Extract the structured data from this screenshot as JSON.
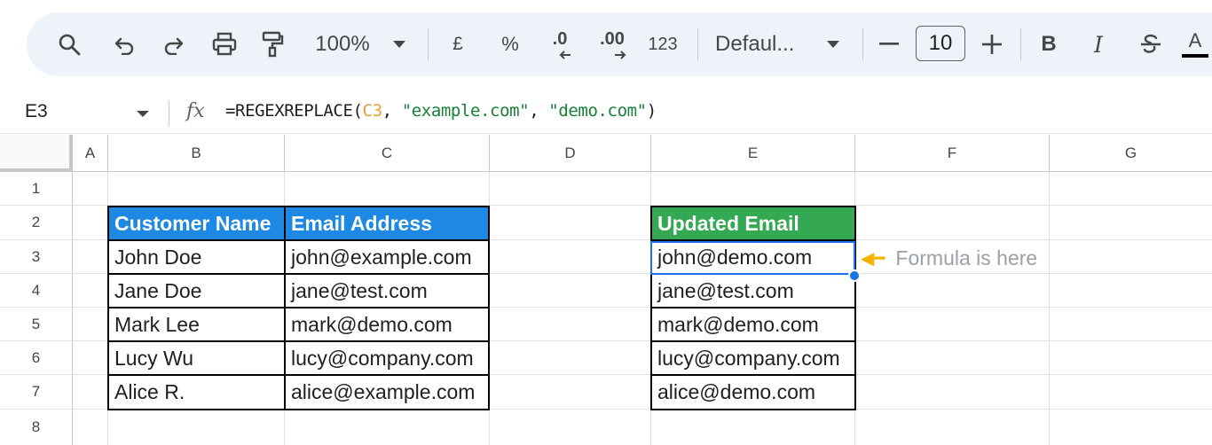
{
  "toolbar": {
    "zoom": "100%",
    "currency": "£",
    "percent": "%",
    "decrease_decimal": ".0",
    "increase_decimal": ".00",
    "number_format": "123",
    "font_name": "Defaul...",
    "font_size": "10",
    "icons": [
      "search-icon",
      "undo-icon",
      "redo-icon",
      "print-icon",
      "paint-format-icon",
      "dropdown-arrow-icon",
      "minus-icon",
      "plus-icon",
      "bold-icon",
      "italic-icon",
      "strikethrough-icon",
      "text-color-icon"
    ]
  },
  "formula_bar": {
    "name_box": "E3",
    "fx": "fx",
    "formula_prefix": "=REGEXREPLACE(",
    "formula_ref": "C3",
    "formula_sep1": ", ",
    "formula_arg1": "\"example.com\"",
    "formula_sep2": ", ",
    "formula_arg2": "\"demo.com\"",
    "formula_suffix": ")"
  },
  "columns": [
    "A",
    "B",
    "C",
    "D",
    "E",
    "F",
    "G"
  ],
  "rows": [
    "1",
    "2",
    "3",
    "4",
    "5",
    "6",
    "7",
    "8"
  ],
  "table": {
    "headers": [
      "Customer Name",
      "Email Address"
    ],
    "rows": [
      [
        "John Doe",
        "john@example.com"
      ],
      [
        "Jane Doe",
        "jane@test.com"
      ],
      [
        "Mark Lee",
        "mark@demo.com"
      ],
      [
        "Lucy Wu",
        "lucy@company.com"
      ],
      [
        "Alice R.",
        "alice@example.com"
      ]
    ]
  },
  "result": {
    "header": "Updated Email",
    "values": [
      "john@demo.com",
      "jane@test.com",
      "mark@demo.com",
      "lucy@company.com",
      "alice@demo.com"
    ]
  },
  "note": "Formula is here",
  "colors": {
    "blue_header": "#1e88e5",
    "green_header": "#34a853",
    "selection": "#1a73e8",
    "formula_ref": "#e8a13a",
    "formula_string": "#188038"
  }
}
